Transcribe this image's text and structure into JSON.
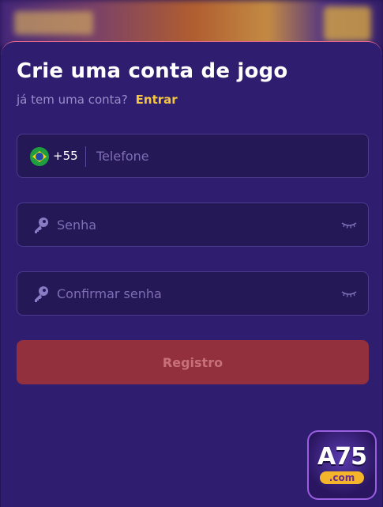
{
  "header": {
    "title": "Crie uma conta de jogo",
    "subtitle": "já tem uma conta?",
    "login_link": "Entrar"
  },
  "form": {
    "phone": {
      "country_flag_icon": "brazil-flag-icon",
      "dial_code": "+55",
      "placeholder": "Telefone"
    },
    "password": {
      "icon": "key-icon",
      "placeholder": "Senha",
      "toggle_icon": "eye-closed-icon"
    },
    "confirm_password": {
      "icon": "key-icon",
      "placeholder": "Confirmar senha",
      "toggle_icon": "eye-closed-icon"
    },
    "submit_label": "Registro"
  },
  "logo": {
    "main": "A75",
    "domain": ".com"
  },
  "colors": {
    "accent_link": "#f5c542",
    "button_bg": "#93303e",
    "panel_bg": "#2f1d70"
  }
}
